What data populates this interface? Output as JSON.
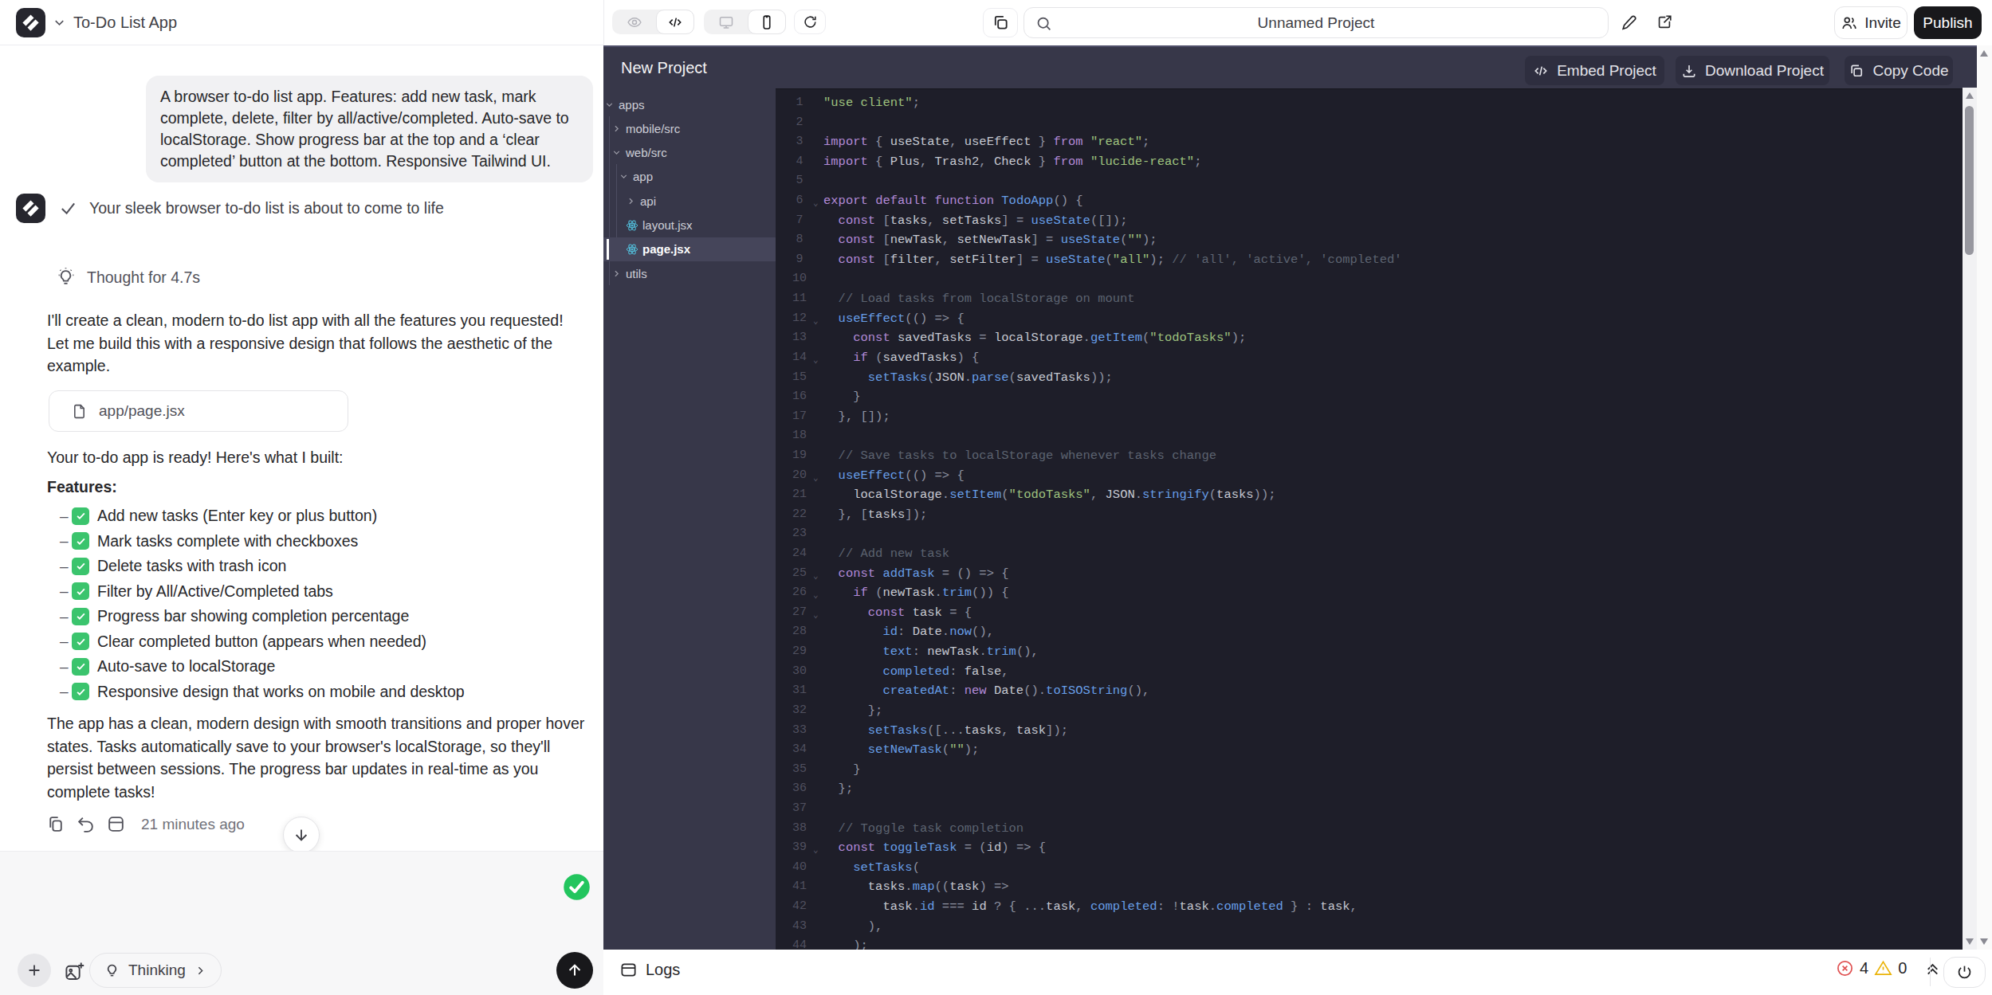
{
  "left": {
    "title": "To-Do List App",
    "user_message": "A browser to-do list app. Features: add new task, mark complete, delete, filter by all/active/completed. Auto-save to localStorage. Show progress bar at the top and a ‘clear completed’ button at the bottom. Responsive Tailwind UI.",
    "status_line": "Your sleek browser to-do list is about to come to life",
    "thought": "Thought for 4.7s",
    "intro": "I'll create a clean, modern to-do list app with all the features you requested! Let me build this with a responsive design that follows the aesthetic of the example.",
    "file_chip": "app/page.jsx",
    "ready": "Your to-do app is ready! Here's what I built:",
    "features_heading": "Features:",
    "features": [
      "Add new tasks (Enter key or plus button)",
      "Mark tasks complete with checkboxes",
      "Delete tasks with trash icon",
      "Filter by All/Active/Completed tabs",
      "Progress bar showing completion percentage",
      "Clear completed button (appears when needed)",
      "Auto-save to localStorage",
      "Responsive design that works on mobile and desktop"
    ],
    "closing": "The app has a clean, modern design with smooth transitions and proper hover states. Tasks automatically save to your browser's localStorage, so they'll persist between sessions. The progress bar updates in real-time as you complete tasks!",
    "timestamp": "21 minutes ago",
    "thinking_label": "Thinking"
  },
  "toolbar": {
    "project_name": "Unnamed Project",
    "invite_label": "Invite",
    "publish_label": "Publish"
  },
  "workspace": {
    "title": "New Project",
    "embed_label": "Embed Project",
    "download_label": "Download Project",
    "copy_label": "Copy Code",
    "tree": [
      {
        "label": "apps",
        "indent": 0,
        "kind": "dir",
        "open": true
      },
      {
        "label": "mobile/src",
        "indent": 1,
        "kind": "dir",
        "open": false
      },
      {
        "label": "web/src",
        "indent": 1,
        "kind": "dir",
        "open": true
      },
      {
        "label": "app",
        "indent": 2,
        "kind": "dir",
        "open": true
      },
      {
        "label": "api",
        "indent": 3,
        "kind": "dir",
        "open": false
      },
      {
        "label": "layout.jsx",
        "indent": 3,
        "kind": "react",
        "open": false
      },
      {
        "label": "page.jsx",
        "indent": 3,
        "kind": "react",
        "open": false,
        "selected": true
      },
      {
        "label": "utils",
        "indent": 1,
        "kind": "dir",
        "open": false
      }
    ],
    "code": [
      {
        "n": 1,
        "t": [
          [
            "s",
            "\"use client\""
          ],
          [
            "p",
            ";"
          ]
        ]
      },
      {
        "n": 2,
        "t": []
      },
      {
        "n": 3,
        "t": [
          [
            "k",
            "import"
          ],
          [
            "p",
            " { "
          ],
          [
            "v",
            "useState"
          ],
          [
            "p",
            ", "
          ],
          [
            "v",
            "useEffect"
          ],
          [
            "p",
            " } "
          ],
          [
            "k",
            "from"
          ],
          [
            "p",
            " "
          ],
          [
            "s",
            "\"react\""
          ],
          [
            "p",
            ";"
          ]
        ]
      },
      {
        "n": 4,
        "t": [
          [
            "k",
            "import"
          ],
          [
            "p",
            " { "
          ],
          [
            "v",
            "Plus"
          ],
          [
            "p",
            ", "
          ],
          [
            "v",
            "Trash2"
          ],
          [
            "p",
            ", "
          ],
          [
            "v",
            "Check"
          ],
          [
            "p",
            " } "
          ],
          [
            "k",
            "from"
          ],
          [
            "p",
            " "
          ],
          [
            "s",
            "\"lucide-react\""
          ],
          [
            "p",
            ";"
          ]
        ]
      },
      {
        "n": 5,
        "t": []
      },
      {
        "n": 6,
        "fold": 1,
        "t": [
          [
            "k",
            "export"
          ],
          [
            "p",
            " "
          ],
          [
            "k",
            "default"
          ],
          [
            "p",
            " "
          ],
          [
            "k",
            "function"
          ],
          [
            "p",
            " "
          ],
          [
            "f",
            "TodoApp"
          ],
          [
            "p",
            "() {"
          ]
        ]
      },
      {
        "n": 7,
        "t": [
          [
            "p",
            "  "
          ],
          [
            "k",
            "const"
          ],
          [
            "p",
            " ["
          ],
          [
            "v",
            "tasks"
          ],
          [
            "p",
            ", "
          ],
          [
            "v",
            "setTasks"
          ],
          [
            "p",
            "] = "
          ],
          [
            "f",
            "useState"
          ],
          [
            "p",
            "([]);"
          ]
        ]
      },
      {
        "n": 8,
        "t": [
          [
            "p",
            "  "
          ],
          [
            "k",
            "const"
          ],
          [
            "p",
            " ["
          ],
          [
            "v",
            "newTask"
          ],
          [
            "p",
            ", "
          ],
          [
            "v",
            "setNewTask"
          ],
          [
            "p",
            "] = "
          ],
          [
            "f",
            "useState"
          ],
          [
            "p",
            "("
          ],
          [
            "s",
            "\"\""
          ],
          [
            "p",
            ");"
          ]
        ]
      },
      {
        "n": 9,
        "t": [
          [
            "p",
            "  "
          ],
          [
            "k",
            "const"
          ],
          [
            "p",
            " ["
          ],
          [
            "v",
            "filter"
          ],
          [
            "p",
            ", "
          ],
          [
            "v",
            "setFilter"
          ],
          [
            "p",
            "] = "
          ],
          [
            "f",
            "useState"
          ],
          [
            "p",
            "("
          ],
          [
            "s",
            "\"all\""
          ],
          [
            "p",
            ");"
          ],
          [
            "c",
            " // 'all', 'active', 'completed'"
          ]
        ]
      },
      {
        "n": 10,
        "t": []
      },
      {
        "n": 11,
        "t": [
          [
            "p",
            "  "
          ],
          [
            "c",
            "// Load tasks from localStorage on mount"
          ]
        ]
      },
      {
        "n": 12,
        "fold": 1,
        "t": [
          [
            "p",
            "  "
          ],
          [
            "f",
            "useEffect"
          ],
          [
            "p",
            "(() => {"
          ]
        ]
      },
      {
        "n": 13,
        "t": [
          [
            "p",
            "    "
          ],
          [
            "k",
            "const"
          ],
          [
            "p",
            " "
          ],
          [
            "v",
            "savedTasks"
          ],
          [
            "p",
            " = "
          ],
          [
            "v",
            "localStorage"
          ],
          [
            "p",
            "."
          ],
          [
            "f",
            "getItem"
          ],
          [
            "p",
            "("
          ],
          [
            "s",
            "\"todoTasks\""
          ],
          [
            "p",
            ");"
          ]
        ]
      },
      {
        "n": 14,
        "fold": 1,
        "t": [
          [
            "p",
            "    "
          ],
          [
            "k",
            "if"
          ],
          [
            "p",
            " ("
          ],
          [
            "v",
            "savedTasks"
          ],
          [
            "p",
            ") {"
          ]
        ]
      },
      {
        "n": 15,
        "t": [
          [
            "p",
            "      "
          ],
          [
            "f",
            "setTasks"
          ],
          [
            "p",
            "("
          ],
          [
            "v",
            "JSON"
          ],
          [
            "p",
            "."
          ],
          [
            "f",
            "parse"
          ],
          [
            "p",
            "("
          ],
          [
            "v",
            "savedTasks"
          ],
          [
            "p",
            "));"
          ]
        ]
      },
      {
        "n": 16,
        "t": [
          [
            "p",
            "    }"
          ]
        ]
      },
      {
        "n": 17,
        "t": [
          [
            "p",
            "  }, []);"
          ]
        ]
      },
      {
        "n": 18,
        "t": []
      },
      {
        "n": 19,
        "t": [
          [
            "p",
            "  "
          ],
          [
            "c",
            "// Save tasks to localStorage whenever tasks change"
          ]
        ]
      },
      {
        "n": 20,
        "fold": 1,
        "t": [
          [
            "p",
            "  "
          ],
          [
            "f",
            "useEffect"
          ],
          [
            "p",
            "(() => {"
          ]
        ]
      },
      {
        "n": 21,
        "t": [
          [
            "p",
            "    "
          ],
          [
            "v",
            "localStorage"
          ],
          [
            "p",
            "."
          ],
          [
            "f",
            "setItem"
          ],
          [
            "p",
            "("
          ],
          [
            "s",
            "\"todoTasks\""
          ],
          [
            "p",
            ", "
          ],
          [
            "v",
            "JSON"
          ],
          [
            "p",
            "."
          ],
          [
            "f",
            "stringify"
          ],
          [
            "p",
            "("
          ],
          [
            "v",
            "tasks"
          ],
          [
            "p",
            "));"
          ]
        ]
      },
      {
        "n": 22,
        "t": [
          [
            "p",
            "  }, ["
          ],
          [
            "v",
            "tasks"
          ],
          [
            "p",
            "]);"
          ]
        ]
      },
      {
        "n": 23,
        "t": []
      },
      {
        "n": 24,
        "t": [
          [
            "p",
            "  "
          ],
          [
            "c",
            "// Add new task"
          ]
        ]
      },
      {
        "n": 25,
        "fold": 1,
        "t": [
          [
            "p",
            "  "
          ],
          [
            "k",
            "const"
          ],
          [
            "p",
            " "
          ],
          [
            "f",
            "addTask"
          ],
          [
            "p",
            " = () => {"
          ]
        ]
      },
      {
        "n": 26,
        "fold": 1,
        "t": [
          [
            "p",
            "    "
          ],
          [
            "k",
            "if"
          ],
          [
            "p",
            " ("
          ],
          [
            "v",
            "newTask"
          ],
          [
            "p",
            "."
          ],
          [
            "f",
            "trim"
          ],
          [
            "p",
            "()) {"
          ]
        ]
      },
      {
        "n": 27,
        "fold": 1,
        "t": [
          [
            "p",
            "      "
          ],
          [
            "k",
            "const"
          ],
          [
            "p",
            " "
          ],
          [
            "v",
            "task"
          ],
          [
            "p",
            " = {"
          ]
        ]
      },
      {
        "n": 28,
        "t": [
          [
            "p",
            "        "
          ],
          [
            "f",
            "id"
          ],
          [
            "p",
            ": "
          ],
          [
            "v",
            "Date"
          ],
          [
            "p",
            "."
          ],
          [
            "f",
            "now"
          ],
          [
            "p",
            "(),"
          ]
        ]
      },
      {
        "n": 29,
        "t": [
          [
            "p",
            "        "
          ],
          [
            "f",
            "text"
          ],
          [
            "p",
            ": "
          ],
          [
            "v",
            "newTask"
          ],
          [
            "p",
            "."
          ],
          [
            "f",
            "trim"
          ],
          [
            "p",
            "(),"
          ]
        ]
      },
      {
        "n": 30,
        "t": [
          [
            "p",
            "        "
          ],
          [
            "f",
            "completed"
          ],
          [
            "p",
            ": "
          ],
          [
            "v",
            "false"
          ],
          [
            "p",
            ","
          ]
        ]
      },
      {
        "n": 31,
        "t": [
          [
            "p",
            "        "
          ],
          [
            "f",
            "createdAt"
          ],
          [
            "p",
            ": "
          ],
          [
            "k",
            "new"
          ],
          [
            "p",
            " "
          ],
          [
            "v",
            "Date"
          ],
          [
            "p",
            "()."
          ],
          [
            "f",
            "toISOString"
          ],
          [
            "p",
            "(),"
          ]
        ]
      },
      {
        "n": 32,
        "t": [
          [
            "p",
            "      };"
          ]
        ]
      },
      {
        "n": 33,
        "t": [
          [
            "p",
            "      "
          ],
          [
            "f",
            "setTasks"
          ],
          [
            "p",
            "([..."
          ],
          [
            "v",
            "tasks"
          ],
          [
            "p",
            ", "
          ],
          [
            "v",
            "task"
          ],
          [
            "p",
            "]);"
          ]
        ]
      },
      {
        "n": 34,
        "t": [
          [
            "p",
            "      "
          ],
          [
            "f",
            "setNewTask"
          ],
          [
            "p",
            "("
          ],
          [
            "s",
            "\"\""
          ],
          [
            "p",
            ");"
          ]
        ]
      },
      {
        "n": 35,
        "t": [
          [
            "p",
            "    }"
          ]
        ]
      },
      {
        "n": 36,
        "t": [
          [
            "p",
            "  };"
          ]
        ]
      },
      {
        "n": 37,
        "t": []
      },
      {
        "n": 38,
        "t": [
          [
            "p",
            "  "
          ],
          [
            "c",
            "// Toggle task completion"
          ]
        ]
      },
      {
        "n": 39,
        "fold": 1,
        "t": [
          [
            "p",
            "  "
          ],
          [
            "k",
            "const"
          ],
          [
            "p",
            " "
          ],
          [
            "f",
            "toggleTask"
          ],
          [
            "p",
            " = ("
          ],
          [
            "v",
            "id"
          ],
          [
            "p",
            ") => {"
          ]
        ]
      },
      {
        "n": 40,
        "t": [
          [
            "p",
            "    "
          ],
          [
            "f",
            "setTasks"
          ],
          [
            "p",
            "("
          ]
        ]
      },
      {
        "n": 41,
        "t": [
          [
            "p",
            "      "
          ],
          [
            "v",
            "tasks"
          ],
          [
            "p",
            "."
          ],
          [
            "f",
            "map"
          ],
          [
            "p",
            "(("
          ],
          [
            "v",
            "task"
          ],
          [
            "p",
            ") =>"
          ]
        ]
      },
      {
        "n": 42,
        "t": [
          [
            "p",
            "        "
          ],
          [
            "v",
            "task"
          ],
          [
            "p",
            "."
          ],
          [
            "f",
            "id"
          ],
          [
            "p",
            " === "
          ],
          [
            "v",
            "id"
          ],
          [
            "p",
            " ? { ..."
          ],
          [
            "v",
            "task"
          ],
          [
            "p",
            ", "
          ],
          [
            "f",
            "completed"
          ],
          [
            "p",
            ": !"
          ],
          [
            "v",
            "task"
          ],
          [
            "p",
            "."
          ],
          [
            "f",
            "completed"
          ],
          [
            "p",
            " } : "
          ],
          [
            "v",
            "task"
          ],
          [
            "p",
            ","
          ]
        ]
      },
      {
        "n": 43,
        "t": [
          [
            "p",
            "      ),"
          ]
        ]
      },
      {
        "n": 44,
        "t": [
          [
            "p",
            "    );"
          ]
        ]
      }
    ]
  },
  "statusbar": {
    "logs_label": "Logs",
    "error_count": "4",
    "warning_count": "0"
  },
  "colors": {
    "publish_bg": "#18181b",
    "feature_check_green": "#3bc46d",
    "status_green": "#22c55e",
    "error_red": "#dc2626",
    "warning_amber": "#eab308"
  }
}
